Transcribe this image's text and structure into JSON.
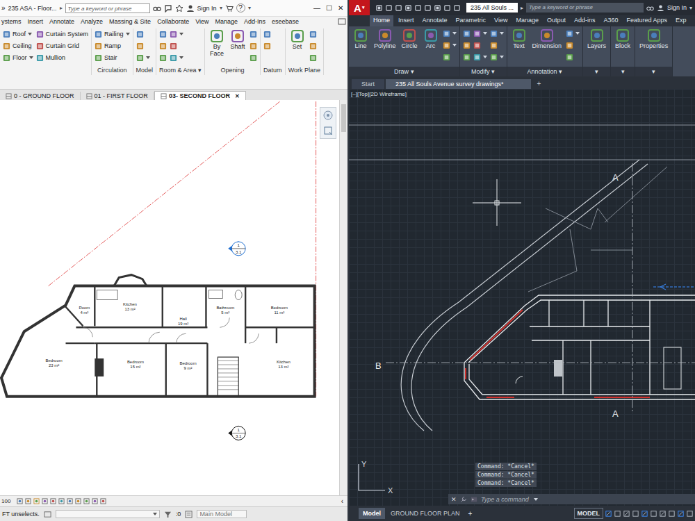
{
  "revit": {
    "title_bar": {
      "overflow": "»",
      "title": "235 ASA - Floor...",
      "title_arrow": "▸",
      "search_placeholder": "Type a keyword or phrase",
      "sign_in": "Sign In",
      "sign_in_arrow": "▾",
      "help": "?",
      "help_arrow": "▾",
      "controls": [
        "—",
        "☐",
        "✕"
      ]
    },
    "tabs": [
      {
        "label": "ystems",
        "selected": false
      },
      {
        "label": "Insert",
        "selected": false
      },
      {
        "label": "Annotate",
        "selected": false
      },
      {
        "label": "Analyze",
        "selected": false
      },
      {
        "label": "Massing & Site",
        "selected": false
      },
      {
        "label": "Collaborate",
        "selected": false
      },
      {
        "label": "View",
        "selected": false
      },
      {
        "label": "Manage",
        "selected": false
      },
      {
        "label": "Add-Ins",
        "selected": false
      },
      {
        "label": "eseebase",
        "selected": false
      }
    ],
    "ribbon_groups": [
      {
        "columns": [
          [
            {
              "label": "Roof",
              "menu": true
            },
            {
              "label": "Ceiling",
              "menu": false
            },
            {
              "label": "Floor",
              "menu": true
            }
          ],
          [
            {
              "label": "Curtain System",
              "menu": false
            },
            {
              "label": "Curtain Grid",
              "menu": false
            },
            {
              "label": "Mullion",
              "menu": false
            }
          ]
        ]
      },
      {
        "label": "Circulation",
        "columns": [
          [
            {
              "label": "Railing",
              "menu": true
            },
            {
              "label": "Ramp",
              "menu": false
            },
            {
              "label": "Stair",
              "menu": false
            }
          ]
        ]
      },
      {
        "label": "Model",
        "columns": [
          [
            {
              "menu": false
            },
            {
              "menu": false
            },
            {
              "menu": true
            }
          ]
        ]
      },
      {
        "label": "Room & Area ▾",
        "columns": [
          [
            {
              "menu": false
            },
            {
              "menu": false
            },
            {
              "menu": false
            }
          ],
          [
            {
              "menu": true
            },
            {
              "menu": false
            },
            {
              "menu": true
            }
          ]
        ]
      },
      {
        "label": "Opening",
        "big": [
          "By Face",
          "Shaft"
        ],
        "columns": [
          [
            {
              "menu": false
            },
            {
              "menu": false
            },
            {
              "menu": false
            }
          ]
        ]
      },
      {
        "label": "Datum",
        "columns": [
          [
            {
              "menu": false
            },
            {
              "menu": false
            }
          ]
        ]
      },
      {
        "label": "Work Plane",
        "big": [
          "Set"
        ],
        "columns": [
          [
            {
              "menu": false
            },
            {
              "menu": false
            },
            {
              "menu": false
            }
          ]
        ]
      }
    ],
    "view_tabs": [
      {
        "label": "0 - GROUND FLOOR",
        "selected": false,
        "closable": false
      },
      {
        "label": "01 - FIRST FLOOR",
        "selected": false,
        "closable": false
      },
      {
        "label": "03- SECOND FLOOR",
        "selected": true,
        "closable": true
      }
    ],
    "close_glyph": "✕",
    "plan": {
      "rooms": [
        {
          "name": "Room",
          "area": "4 m²"
        },
        {
          "name": "Kitchen",
          "area": "13 m²"
        },
        {
          "name": "Hall",
          "area": "19 m²"
        },
        {
          "name": "Bathroom",
          "area": "5 m²"
        },
        {
          "name": "Bedroom",
          "area": "11 m²"
        },
        {
          "name": "Bedroom",
          "area": "23 m²"
        },
        {
          "name": "Bedroom",
          "area": "15 m²"
        },
        {
          "name": "Bedroom",
          "area": "9 m²"
        },
        {
          "name": "Kitchen",
          "area": "13 m²"
        }
      ],
      "section_marks": [
        {
          "number": "1",
          "sheet": "3.1",
          "highlighted": true
        },
        {
          "number": "1",
          "sheet": "3.1",
          "highlighted": false
        }
      ]
    },
    "view_bar": {
      "scale": "100",
      "scroll_glyph": "‹"
    },
    "status_bar": {
      "message": "FT unselects.",
      "selection_count": ":0",
      "model": "Main Model"
    }
  },
  "autocad": {
    "title_bar": {
      "logo": "A",
      "logo_arrow": "▾",
      "title": "235 All Souls ...",
      "title_arrow": "▸",
      "search_placeholder": "Type a keyword or phrase",
      "sign_in": "Sign In",
      "sign_in_arrow": "▾"
    },
    "tabs": [
      {
        "label": "Home",
        "selected": true
      },
      {
        "label": "Insert",
        "selected": false
      },
      {
        "label": "Annotate",
        "selected": false
      },
      {
        "label": "Parametric",
        "selected": false
      },
      {
        "label": "View",
        "selected": false
      },
      {
        "label": "Manage",
        "selected": false
      },
      {
        "label": "Output",
        "selected": false
      },
      {
        "label": "Add-ins",
        "selected": false
      },
      {
        "label": "A360",
        "selected": false
      },
      {
        "label": "Featured Apps",
        "selected": false
      },
      {
        "label": "Exp",
        "selected": false
      }
    ],
    "ribbon_groups": [
      {
        "label": "Draw ▾",
        "big": [
          "Line",
          "Polyline",
          "Circle",
          "Arc"
        ],
        "columns": [
          [
            {
              "menu": true
            },
            {
              "menu": true
            },
            {
              "menu": false
            }
          ]
        ]
      },
      {
        "label": "Modify ▾",
        "columns": [
          [
            {
              "menu": false
            },
            {
              "menu": false
            },
            {
              "menu": false
            }
          ],
          [
            {
              "menu": true
            },
            {
              "menu": false
            },
            {
              "menu": true
            }
          ],
          [
            {
              "menu": true
            },
            {
              "menu": false
            },
            {
              "menu": true
            }
          ]
        ]
      },
      {
        "label": "Annotation ▾",
        "big": [
          "Text",
          "Dimension"
        ],
        "columns": [
          [
            {
              "menu": true
            },
            {
              "menu": false
            },
            {
              "menu": false
            }
          ]
        ]
      },
      {
        "label": "▾",
        "big": [
          "Layers"
        ]
      },
      {
        "label": "▾",
        "big": [
          "Block"
        ]
      },
      {
        "label": "▾",
        "big": [
          "Properties"
        ]
      }
    ],
    "file_tabs": [
      {
        "label": "Start",
        "selected": false
      },
      {
        "label": "235 All Souls Avenue survey drawings*",
        "selected": true
      }
    ],
    "new_tab": "+",
    "viewport_label": "[–][Top][2D Wireframe]",
    "drawing_labels": [
      "A",
      "B",
      "A"
    ],
    "command_history": [
      "Command: *Cancel*",
      "Command: *Cancel*",
      "Command: *Cancel*"
    ],
    "command_input": {
      "close_glyph": "✕",
      "placeholder": "Type a command"
    },
    "ucs": {
      "y": "Y",
      "x": "X"
    },
    "layout_tabs": [
      {
        "label": "Model",
        "selected": true
      },
      {
        "label": "GROUND FLOOR PLAN",
        "selected": false
      }
    ],
    "layout_add": "+",
    "status": {
      "mode": "MODEL"
    }
  }
}
